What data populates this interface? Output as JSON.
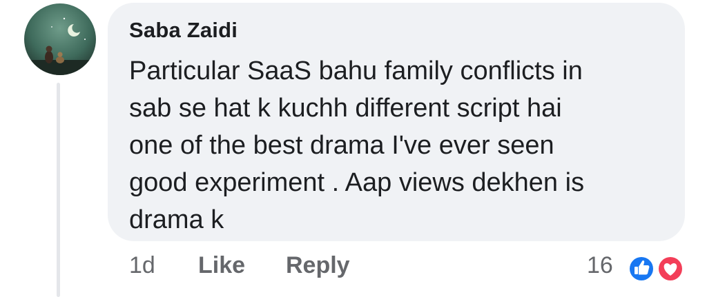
{
  "comment": {
    "author": "Saba Zaidi",
    "text_lines": [
      "Particular SaaS bahu family conflicts in",
      "sab se hat k kuchh different script hai",
      "one of the best drama I've ever seen",
      "good experiment . Aap views dekhen is",
      "drama k"
    ],
    "timestamp": "1d",
    "like_label": "Like",
    "reply_label": "Reply",
    "reaction_count": "16",
    "reactions": [
      "like-icon",
      "love-icon"
    ]
  },
  "colors": {
    "bubble": "#f0f2f5",
    "text": "#1c1e21",
    "secondary": "#65676b",
    "like_blue": "#1877f2",
    "love_red": "#f33e58"
  }
}
